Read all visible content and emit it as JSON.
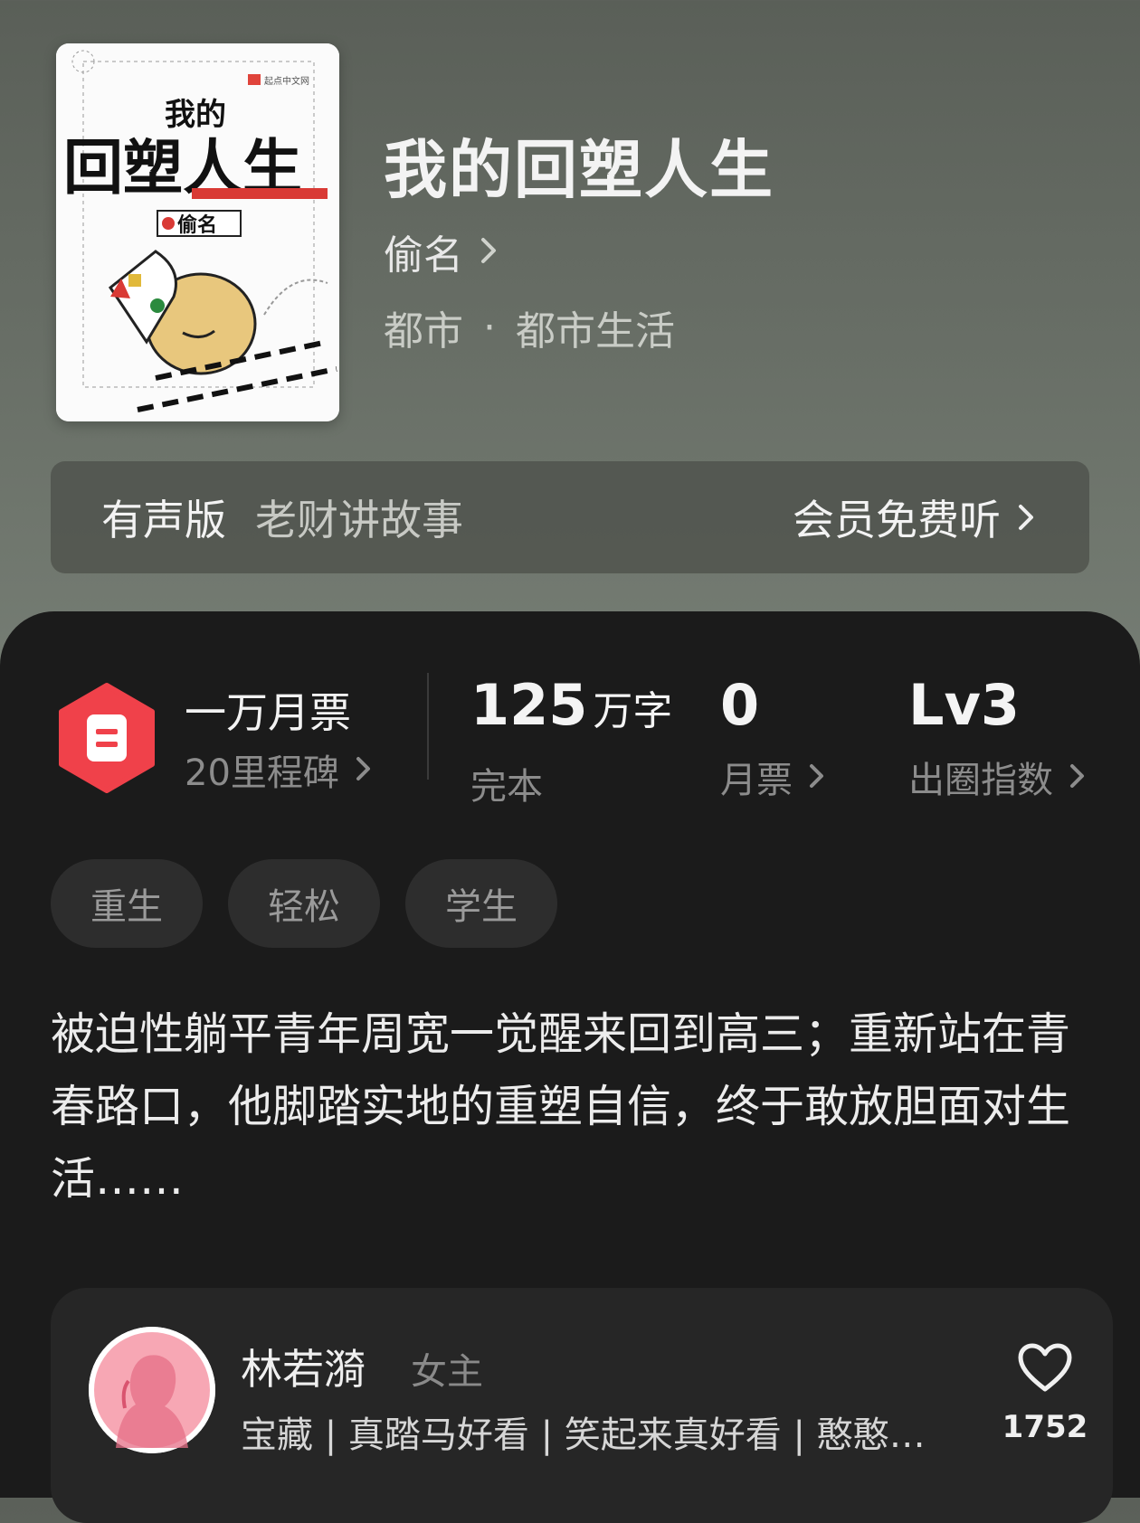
{
  "colors": {
    "accent_red": "#f0414a",
    "panel_bg": "#1b1b1b",
    "pink": "#f59aa9"
  },
  "book": {
    "title": "我的回塑人生",
    "author": "偷名",
    "genre_main": "都市",
    "genre_sub": "都市生活",
    "genre_dot": "·",
    "cover_texts": {
      "line1": "我的",
      "line2": "回塑人生",
      "author": "偷名",
      "publisher": "起点中文网"
    }
  },
  "audio": {
    "label": "有声版",
    "narrator": "老财讲故事",
    "cta": "会员免费听"
  },
  "stats": {
    "ticket_title": "一万月票",
    "ticket_sub": "20里程碑",
    "words_value": "125",
    "words_unit": "万字",
    "words_label": "完本",
    "monthly_value": "0",
    "monthly_label": "月票",
    "level_value": "Lv3",
    "level_label": "出圈指数"
  },
  "tags": [
    "重生",
    "轻松",
    "学生"
  ],
  "synopsis": "被迫性躺平青年周宽一觉醒来回到高三；重新站在青春路口，他脚踏实地的重塑自信，终于敢放胆面对生活……",
  "character": {
    "name": "林若漪",
    "role": "女主",
    "tags": "宝藏 | 真踏马好看 | 笑起来真好看 | 憨憨…",
    "likes": "1752"
  },
  "icons": [
    "chevron-right-icon",
    "ticket-icon",
    "heart-icon",
    "avatar-silhouette"
  ]
}
